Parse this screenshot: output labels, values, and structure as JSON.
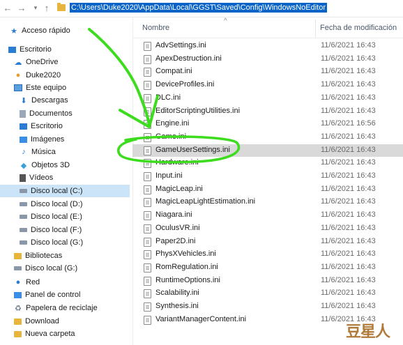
{
  "address_bar": {
    "path": "C:\\Users\\Duke2020\\AppData\\Local\\GGST\\Saved\\Config\\WindowsNoEditor"
  },
  "columns": {
    "name": "Nombre",
    "date": "Fecha de modificación"
  },
  "sidebar": {
    "items": [
      {
        "label": "Acceso rápido",
        "icon": "star-icon"
      },
      {
        "label": "Escritorio",
        "icon": "desktop-icon"
      },
      {
        "label": "OneDrive",
        "icon": "cloud-icon"
      },
      {
        "label": "Duke2020",
        "icon": "user-icon"
      },
      {
        "label": "Este equipo",
        "icon": "computer-icon"
      },
      {
        "label": "Descargas",
        "icon": "download-icon"
      },
      {
        "label": "Documentos",
        "icon": "documents-icon"
      },
      {
        "label": "Escritorio",
        "icon": "desktop-icon"
      },
      {
        "label": "Imágenes",
        "icon": "pictures-icon"
      },
      {
        "label": "Música",
        "icon": "music-icon"
      },
      {
        "label": "Objetos 3D",
        "icon": "objects-3d-icon"
      },
      {
        "label": "Vídeos",
        "icon": "videos-icon"
      },
      {
        "label": "Disco local (C:)",
        "icon": "drive-icon"
      },
      {
        "label": "Disco local (D:)",
        "icon": "drive-icon"
      },
      {
        "label": "Disco local (E:)",
        "icon": "drive-icon"
      },
      {
        "label": "Disco local (F:)",
        "icon": "drive-icon"
      },
      {
        "label": "Disco local (G:)",
        "icon": "drive-icon"
      },
      {
        "label": "Bibliotecas",
        "icon": "libraries-icon"
      },
      {
        "label": "Disco local (G:)",
        "icon": "drive-icon"
      },
      {
        "label": "Red",
        "icon": "network-icon"
      },
      {
        "label": "Panel de control",
        "icon": "control-panel-icon"
      },
      {
        "label": "Papelera de reciclaje",
        "icon": "recycle-bin-icon"
      },
      {
        "label": "Download",
        "icon": "folder-icon"
      },
      {
        "label": "Nueva carpeta",
        "icon": "folder-icon"
      }
    ]
  },
  "files": [
    {
      "name": "AdvSettings.ini",
      "date": "11/6/2021 16:43"
    },
    {
      "name": "ApexDestruction.ini",
      "date": "11/6/2021 16:43"
    },
    {
      "name": "Compat.ini",
      "date": "11/6/2021 16:43"
    },
    {
      "name": "DeviceProfiles.ini",
      "date": "11/6/2021 16:43"
    },
    {
      "name": "DLC.ini",
      "date": "11/6/2021 16:43"
    },
    {
      "name": "EditorScriptingUtilities.ini",
      "date": "11/6/2021 16:43"
    },
    {
      "name": "Engine.ini",
      "date": "11/6/2021 16:56"
    },
    {
      "name": "Game.ini",
      "date": "11/6/2021 16:43"
    },
    {
      "name": "GameUserSettings.ini",
      "date": "11/6/2021 16:43"
    },
    {
      "name": "Hardware.ini",
      "date": "11/6/2021 16:43"
    },
    {
      "name": "Input.ini",
      "date": "11/6/2021 16:43"
    },
    {
      "name": "MagicLeap.ini",
      "date": "11/6/2021 16:43"
    },
    {
      "name": "MagicLeapLightEstimation.ini",
      "date": "11/6/2021 16:43"
    },
    {
      "name": "Niagara.ini",
      "date": "11/6/2021 16:43"
    },
    {
      "name": "OculusVR.ini",
      "date": "11/6/2021 16:43"
    },
    {
      "name": "Paper2D.ini",
      "date": "11/6/2021 16:43"
    },
    {
      "name": "PhysXVehicles.ini",
      "date": "11/6/2021 16:43"
    },
    {
      "name": "RomRegulation.ini",
      "date": "11/6/2021 16:43"
    },
    {
      "name": "RuntimeOptions.ini",
      "date": "11/6/2021 16:43"
    },
    {
      "name": "Scalability.ini",
      "date": "11/6/2021 16:43"
    },
    {
      "name": "Synthesis.ini",
      "date": "11/6/2021 16:43"
    },
    {
      "name": "VariantManagerContent.ini",
      "date": "11/6/2021 16:43"
    }
  ],
  "selected_file": "GameUserSettings.ini",
  "selected_sidebar": "Disco local (C:)",
  "annotation_color": "#3ddc1e",
  "watermark": "豆星人"
}
